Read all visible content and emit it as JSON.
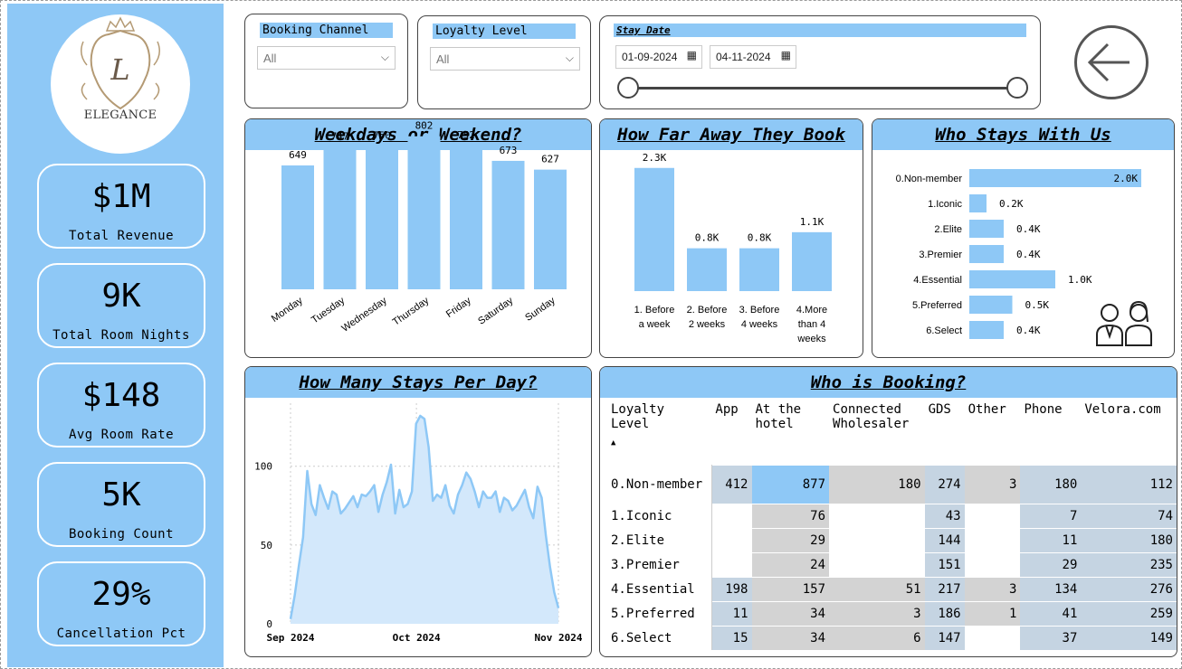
{
  "brand": {
    "logo_monogram": "L",
    "logo_text": "ELEGANCE"
  },
  "kpis": [
    {
      "value": "$1M",
      "label": "Total Revenue"
    },
    {
      "value": "9K",
      "label": "Total Room Nights"
    },
    {
      "value": "$148",
      "label": "Avg Room Rate"
    },
    {
      "value": "5K",
      "label": "Booking Count"
    },
    {
      "value": "29%",
      "label": "Cancellation Pct"
    }
  ],
  "filters": {
    "booking_channel": {
      "title": "Booking Channel",
      "value": "All"
    },
    "loyalty_level": {
      "title": "Loyalty Level",
      "value": "All"
    },
    "stay_date": {
      "title": "Stay Date",
      "start": "01-09-2024",
      "end": "04-11-2024"
    }
  },
  "colors": {
    "accent": "#8ec8f6",
    "table_dark": "#c5d4e2",
    "table_gray": "#d3d3d3",
    "line": "#8ec8f6"
  },
  "charts": {
    "weekday": {
      "title": "Weekdays or Weekend?"
    },
    "leadtime": {
      "title": "How Far Away They Book"
    },
    "loyalty": {
      "title": "Who Stays With Us"
    },
    "stays": {
      "title": "How Many Stays Per Day?"
    },
    "booking": {
      "title": "Who is Booking?"
    }
  },
  "chart_data": [
    {
      "type": "bar",
      "title": "Weekdays or Weekend?",
      "categories": [
        "Monday",
        "Tuesday",
        "Wednesday",
        "Thursday",
        "Friday",
        "Saturday",
        "Sunday"
      ],
      "values": [
        649,
        747,
        750,
        802,
        752,
        673,
        627
      ],
      "labels": [
        "649",
        "747",
        "750",
        "802",
        "752",
        "673",
        "627"
      ],
      "ylim": [
        0,
        900
      ]
    },
    {
      "type": "bar",
      "title": "How Far Away They Book",
      "categories": [
        "1. Before a week",
        "2. Before 2 weeks",
        "3. Before 4 weeks",
        "4.More than 4 weeks"
      ],
      "category_lines": [
        [
          "1. Before",
          "a week"
        ],
        [
          "2. Before",
          "2 weeks"
        ],
        [
          "3. Before",
          "4 weeks"
        ],
        [
          "4.More",
          "than 4",
          "weeks"
        ]
      ],
      "values": [
        2300,
        800,
        800,
        1100
      ],
      "labels": [
        "2.3K",
        "0.8K",
        "0.8K",
        "1.1K"
      ],
      "ylim": [
        0,
        2600
      ]
    },
    {
      "type": "bar",
      "orientation": "horizontal",
      "title": "Who Stays With Us",
      "categories": [
        "0.Non-member",
        "1.Iconic",
        "2.Elite",
        "3.Premier",
        "4.Essential",
        "5.Preferred",
        "6.Select"
      ],
      "values": [
        2000,
        200,
        400,
        400,
        1000,
        500,
        400
      ],
      "labels": [
        "2.0K",
        "0.2K",
        "0.4K",
        "0.4K",
        "1.0K",
        "0.5K",
        "0.4K"
      ],
      "xlim": [
        0,
        2000
      ]
    },
    {
      "type": "area",
      "title": "How Many Stays Per Day?",
      "x_start": "2024-09-01",
      "x_end": "2024-11-04",
      "xticks": [
        "Sep 2024",
        "Oct 2024",
        "Nov 2024"
      ],
      "yticks": [
        "0",
        "50",
        "100"
      ],
      "ylim": [
        0,
        140
      ],
      "values": [
        3,
        18,
        37,
        55,
        97,
        76,
        69,
        88,
        80,
        73,
        84,
        82,
        70,
        73,
        77,
        81,
        74,
        82,
        81,
        84,
        88,
        71,
        82,
        90,
        101,
        70,
        85,
        74,
        76,
        84,
        127,
        132,
        130,
        112,
        78,
        82,
        80,
        88,
        75,
        70,
        82,
        88,
        96,
        92,
        84,
        74,
        84,
        80,
        80,
        84,
        71,
        80,
        78,
        72,
        75,
        80,
        85,
        74,
        67,
        87,
        80,
        56,
        36,
        20,
        10
      ]
    },
    {
      "type": "table",
      "title": "Who is Booking?",
      "columns": [
        "Loyalty Level",
        "App",
        "At the hotel",
        "Connected Wholesaler",
        "GDS",
        "Other",
        "Phone",
        "Velora.com"
      ],
      "rows": [
        [
          "0.Non-member",
          "412",
          "877",
          "180",
          "274",
          "3",
          "180",
          "112"
        ],
        [
          "1.Iconic",
          "",
          "76",
          "",
          "43",
          "",
          "7",
          "74"
        ],
        [
          "2.Elite",
          "",
          "29",
          "",
          "144",
          "",
          "11",
          "180"
        ],
        [
          "3.Premier",
          "",
          "24",
          "",
          "151",
          "",
          "29",
          "235"
        ],
        [
          "4.Essential",
          "198",
          "157",
          "51",
          "217",
          "3",
          "134",
          "276"
        ],
        [
          "5.Preferred",
          "11",
          "34",
          "3",
          "186",
          "1",
          "41",
          "259"
        ],
        [
          "6.Select",
          "15",
          "34",
          "6",
          "147",
          "",
          "37",
          "149"
        ]
      ],
      "shading": [
        [
          "dark",
          "hot",
          "gray",
          "dark",
          "gray",
          "dark",
          "dark"
        ],
        [
          "",
          "gray",
          "",
          "dark",
          "",
          "dark",
          "dark"
        ],
        [
          "",
          "gray",
          "",
          "dark",
          "",
          "dark",
          "dark"
        ],
        [
          "",
          "gray",
          "",
          "dark",
          "",
          "dark",
          "dark"
        ],
        [
          "dark",
          "gray",
          "gray",
          "dark",
          "gray",
          "dark",
          "dark"
        ],
        [
          "dark",
          "gray",
          "gray",
          "dark",
          "gray",
          "dark",
          "dark"
        ],
        [
          "dark",
          "gray",
          "gray",
          "dark",
          "",
          "dark",
          "dark"
        ]
      ],
      "sort_icon": "sort-ascending-icon"
    }
  ]
}
